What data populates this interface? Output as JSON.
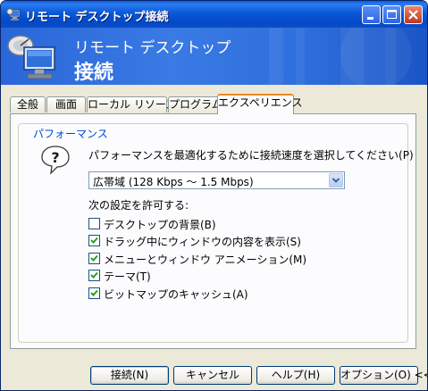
{
  "window": {
    "title": "リモート デスクトップ接続"
  },
  "banner": {
    "line1": "リモート デスクトップ",
    "line2": "接続"
  },
  "tabs": [
    {
      "label": "全般"
    },
    {
      "label": "画面"
    },
    {
      "label": "ローカル リソース"
    },
    {
      "label": "プログラム"
    },
    {
      "label": "エクスペリエンス",
      "active": true
    }
  ],
  "performance": {
    "group_title": "パフォーマンス",
    "label": "パフォーマンスを最適化するために接続速度を選択してください(P)",
    "speed_selected": "広帯域 (128 Kbps ～ 1.5 Mbps)",
    "allow_label": "次の設定を許可する:",
    "options": [
      {
        "label": "デスクトップの背景(B)",
        "checked": false
      },
      {
        "label": "ドラッグ中にウィンドウの内容を表示(S)",
        "checked": true
      },
      {
        "label": "メニューとウィンドウ アニメーション(M)",
        "checked": true
      },
      {
        "label": "テーマ(T)",
        "checked": true
      },
      {
        "label": "ビットマップのキャッシュ(A)",
        "checked": true
      }
    ]
  },
  "buttons": {
    "connect": "接続(N)",
    "cancel": "キャンセル",
    "help": "ヘルプ(H)",
    "options": "オプション(O) <<"
  },
  "colors": {
    "titlebar": "#0348c8",
    "banner": "#2f6fdd",
    "window_bg": "#ece9d8",
    "group_title": "#0046d5",
    "active_tab_accent": "#e68b2c",
    "checkmark": "#21a121"
  }
}
